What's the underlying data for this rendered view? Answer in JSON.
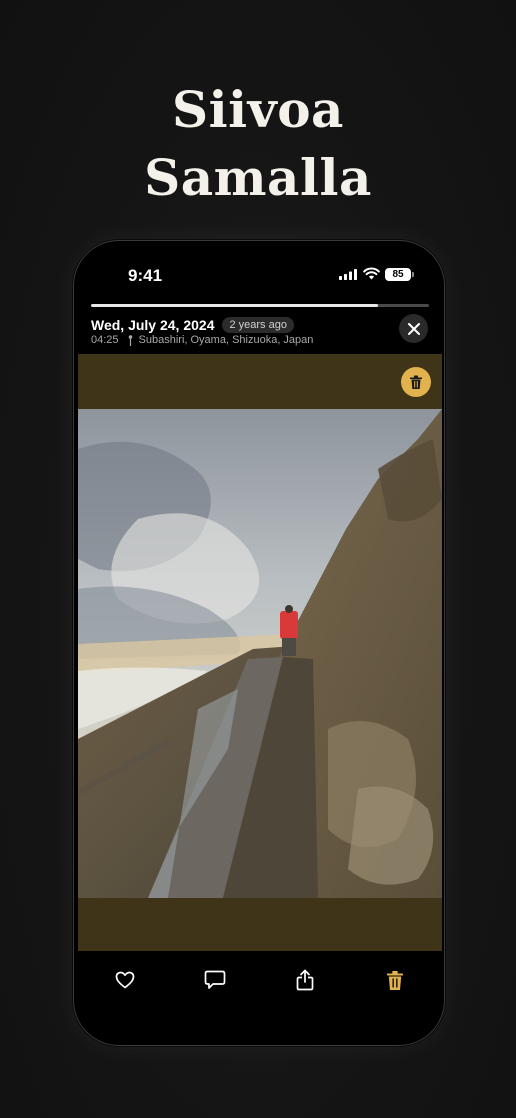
{
  "headline": {
    "line1": "Siivoa",
    "line2": "Samalla"
  },
  "status_bar": {
    "time": "9:41",
    "battery": "85"
  },
  "photo_viewer": {
    "progress": 0.85,
    "date": "Wed, July 24, 2024",
    "age_badge": "2 years ago",
    "time": "04:25",
    "location": "Subashiri, Oyama, Shizuoka, Japan"
  },
  "icons": {
    "signal": "cellular-signal-icon",
    "wifi": "wifi-icon",
    "close": "close-icon",
    "pin": "location-pin-icon",
    "delete": "trash-icon",
    "like": "heart-icon",
    "comment": "comment-icon",
    "share": "share-icon"
  },
  "colors": {
    "background": "#151515",
    "accent": "#e2b24f",
    "media_backdrop": "#3f3418"
  }
}
